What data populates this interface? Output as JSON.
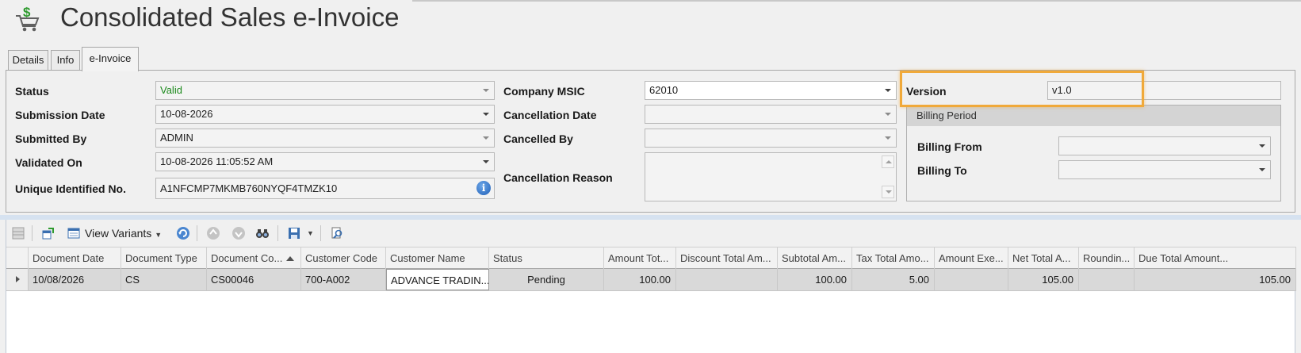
{
  "header": {
    "title": "Consolidated Sales e-Invoice"
  },
  "tabs": [
    {
      "label": "Details"
    },
    {
      "label": "Info"
    },
    {
      "label": "e-Invoice"
    }
  ],
  "form": {
    "status_label": "Status",
    "status_value": "Valid",
    "submission_date_label": "Submission Date",
    "submission_date_value": "10-08-2026",
    "submitted_by_label": "Submitted By",
    "submitted_by_value": "ADMIN",
    "validated_on_label": "Validated On",
    "validated_on_value": "10-08-2026 11:05:52 AM",
    "uin_label": "Unique Identified No.",
    "uin_value": "A1NFCMP7MKMB760NYQF4TMZK10",
    "company_msic_label": "Company MSIC",
    "company_msic_value": "62010",
    "cancellation_date_label": "Cancellation Date",
    "cancellation_date_value": "",
    "cancelled_by_label": "Cancelled By",
    "cancelled_by_value": "",
    "cancellation_reason_label": "Cancellation Reason",
    "cancellation_reason_value": "",
    "version_label": "Version",
    "version_value": "v1.0",
    "billing_period_label": "Billing Period",
    "billing_from_label": "Billing From",
    "billing_from_value": "",
    "billing_to_label": "Billing To",
    "billing_to_value": ""
  },
  "toolbar": {
    "view_variants_label": "View Variants"
  },
  "grid": {
    "columns": [
      "Document Date",
      "Document Type",
      "Document Co...",
      "Customer Code",
      "Customer Name",
      "Status",
      "Amount Tot...",
      "Discount Total Am...",
      "Subtotal Am...",
      "Tax Total Amo...",
      "Amount Exe...",
      "Net Total A...",
      "Roundin...",
      "Due Total Amount..."
    ],
    "rows": [
      {
        "document_date": "10/08/2026",
        "document_type": "CS",
        "document_code": "CS00046",
        "customer_code": "700-A002",
        "customer_name": "ADVANCE TRADIN...",
        "status": "Pending",
        "amount_total": "100.00",
        "discount_total": "",
        "subtotal": "100.00",
        "tax_total": "5.00",
        "amount_exempt": "",
        "net_total": "105.00",
        "rounding": "",
        "due_total": "105.00"
      }
    ]
  },
  "colors": {
    "valid_text": "#1d8a1d",
    "highlight_border": "#f0a93a",
    "row_background": "#d9d9d9"
  }
}
